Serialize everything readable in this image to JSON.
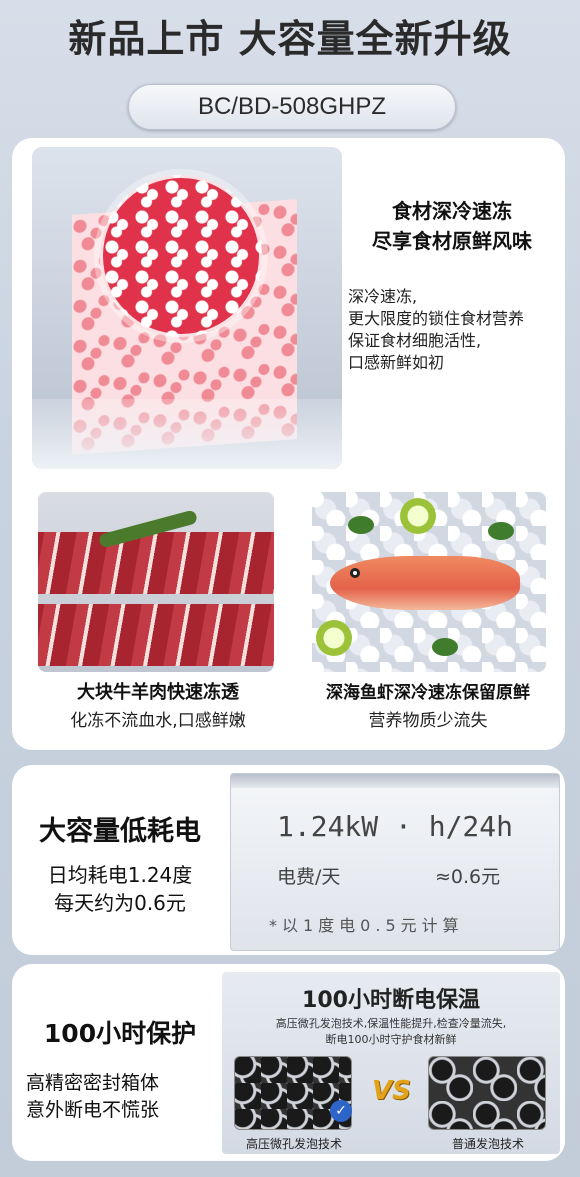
{
  "headline": "新品上市 大容量全新升级",
  "model": "BC/BD-508GHPZ",
  "freeze": {
    "title_line1": "食材深冷速冻",
    "title_line2": "尽享食材原鲜风味",
    "desc_line1": "深冷速冻,",
    "desc_line2": "更大限度的锁住食材营养",
    "desc_line3": "保证食材细胞活性,",
    "desc_line4": "口感新鲜如初"
  },
  "beef": {
    "title": "大块牛羊肉快速冻透",
    "subtitle": "化冻不流血水,口感鲜嫩"
  },
  "seafood": {
    "title": "深海鱼虾深冷速冻保留原鲜",
    "subtitle": "营养物质少流失"
  },
  "power": {
    "title": "大容量低耗电",
    "desc_line1": "日均耗电1.24度",
    "desc_line2": "每天约为0.6元",
    "sticker_line1": "1.24kW · h/24h",
    "sticker_label": "电费/天",
    "sticker_value": "≈0.6元",
    "sticker_note": "*以1度电0.5元计算"
  },
  "protection": {
    "title": "100小时保护",
    "desc_line1": "高精密密封箱体",
    "desc_line2": "意外断电不慌张",
    "panel_title": "100小时断电保温",
    "panel_desc_line1": "高压微孔发泡技术,保温性能提升,检查冷量流失,",
    "panel_desc_line2": "断电100小时守护食材新鲜",
    "vs": "VS",
    "left_caption": "高压微孔发泡技术",
    "right_caption": "普通发泡技术"
  },
  "colors": {
    "accent_vs": "#e2a21a",
    "check_blue": "#2c64c8"
  }
}
